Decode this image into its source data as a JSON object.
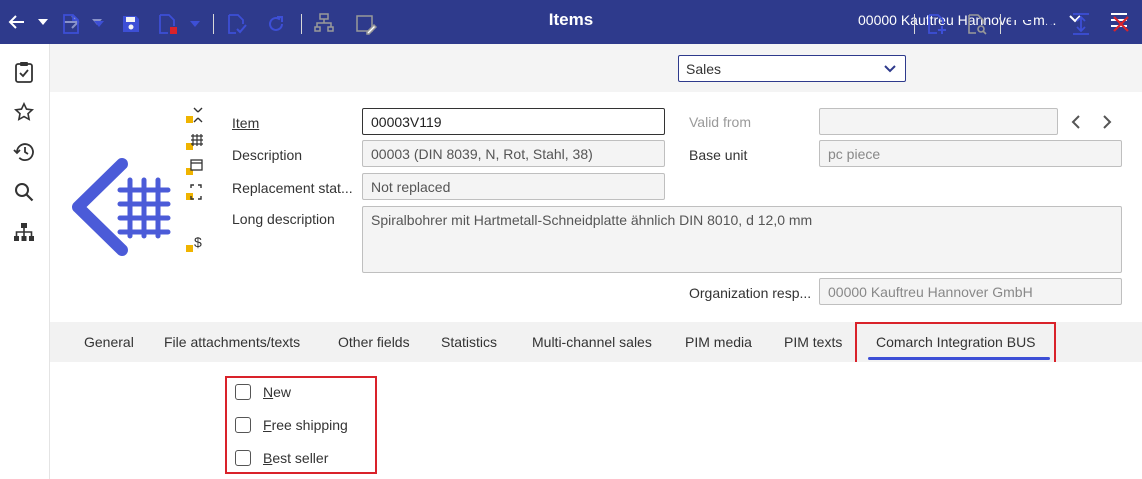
{
  "app": {
    "title": "Items",
    "company": "00000  Kauftreu Hannover Gm..."
  },
  "toolbar": {
    "view_select": "Sales"
  },
  "form": {
    "item_label": "Item",
    "item_value": "00003V119",
    "description_label": "Description",
    "description_value": "00003 (DIN 8039, N, Rot, Stahl, 38)",
    "replacement_label": "Replacement stat...",
    "replacement_value": "Not replaced",
    "long_description_label": "Long description",
    "long_description_value": "Spiralbohrer mit Hartmetall-Schneidplatte ähnlich DIN 8010, d 12,0 mm",
    "valid_from_label": "Valid from",
    "valid_from_value": "",
    "base_unit_label": "Base unit",
    "base_unit_value": "pc piece",
    "org_label": "Organization resp...",
    "org_value": "00000 Kauftreu Hannover GmbH"
  },
  "tabs": [
    {
      "label": "General"
    },
    {
      "label": "File attachments/texts"
    },
    {
      "label": "Other fields"
    },
    {
      "label": "Statistics"
    },
    {
      "label": "Multi-channel sales"
    },
    {
      "label": "PIM media"
    },
    {
      "label": "PIM texts"
    },
    {
      "label": "Comarch Integration BUS"
    }
  ],
  "checkboxes": [
    {
      "label": "New",
      "checked": false
    },
    {
      "label": "Free shipping",
      "checked": false
    },
    {
      "label": "Best seller",
      "checked": false
    }
  ],
  "colors": {
    "topbar": "#2e3a8c",
    "accent": "#3d4fd6",
    "highlight": "#d9222a"
  }
}
